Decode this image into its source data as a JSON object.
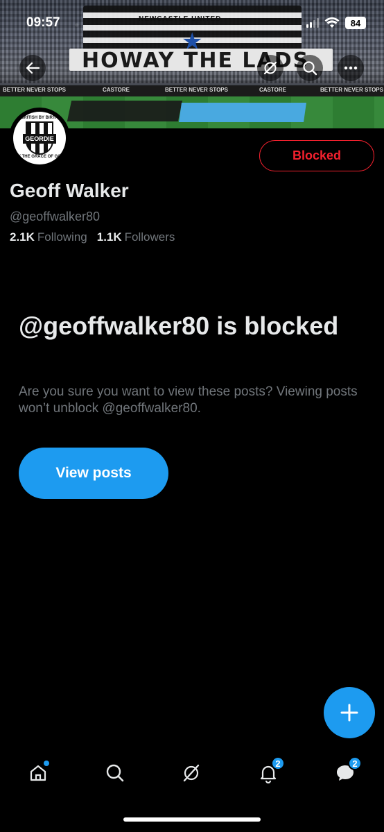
{
  "status_bar": {
    "time": "09:57",
    "battery": "84"
  },
  "banner": {
    "flag_text": "NEWCASTLE UNITED",
    "banner_text": "HOWAY THE LADS",
    "ad_left": "BETTER NEVER STOPS",
    "ad_mid1": "CASTORE",
    "ad_mid2": "BETTER NEVER STOPS",
    "ad_mid3": "CASTORE",
    "ad_right": "BETTER NEVER STOPS"
  },
  "header": {
    "back_icon": "arrow-left-icon",
    "grok_icon": "grok-icon",
    "search_icon": "search-icon",
    "more_icon": "more-icon"
  },
  "avatar": {
    "top_text": "BRITISH BY BIRTH",
    "badge_text": "GEORDIE",
    "bottom_text": "BY THE GRACE OF GOD"
  },
  "profile": {
    "block_button_label": "Blocked",
    "name": "Geoff Walker",
    "handle": "@geoffwalker80",
    "following_count": "2.1K",
    "following_label": "Following",
    "followers_count": "1.1K",
    "followers_label": "Followers"
  },
  "blocked_notice": {
    "title": "@geoffwalker80 is blocked",
    "description": "Are you sure you want to view these posts? Viewing posts won’t unblock @geoffwalker80.",
    "view_button_label": "View posts"
  },
  "compose": {
    "icon": "plus-icon"
  },
  "tabbar": {
    "notifications_badge": "2",
    "messages_badge": "2"
  },
  "colors": {
    "accent": "#1d9bf0",
    "danger": "#f4212e",
    "secondary_text": "#71767b"
  }
}
